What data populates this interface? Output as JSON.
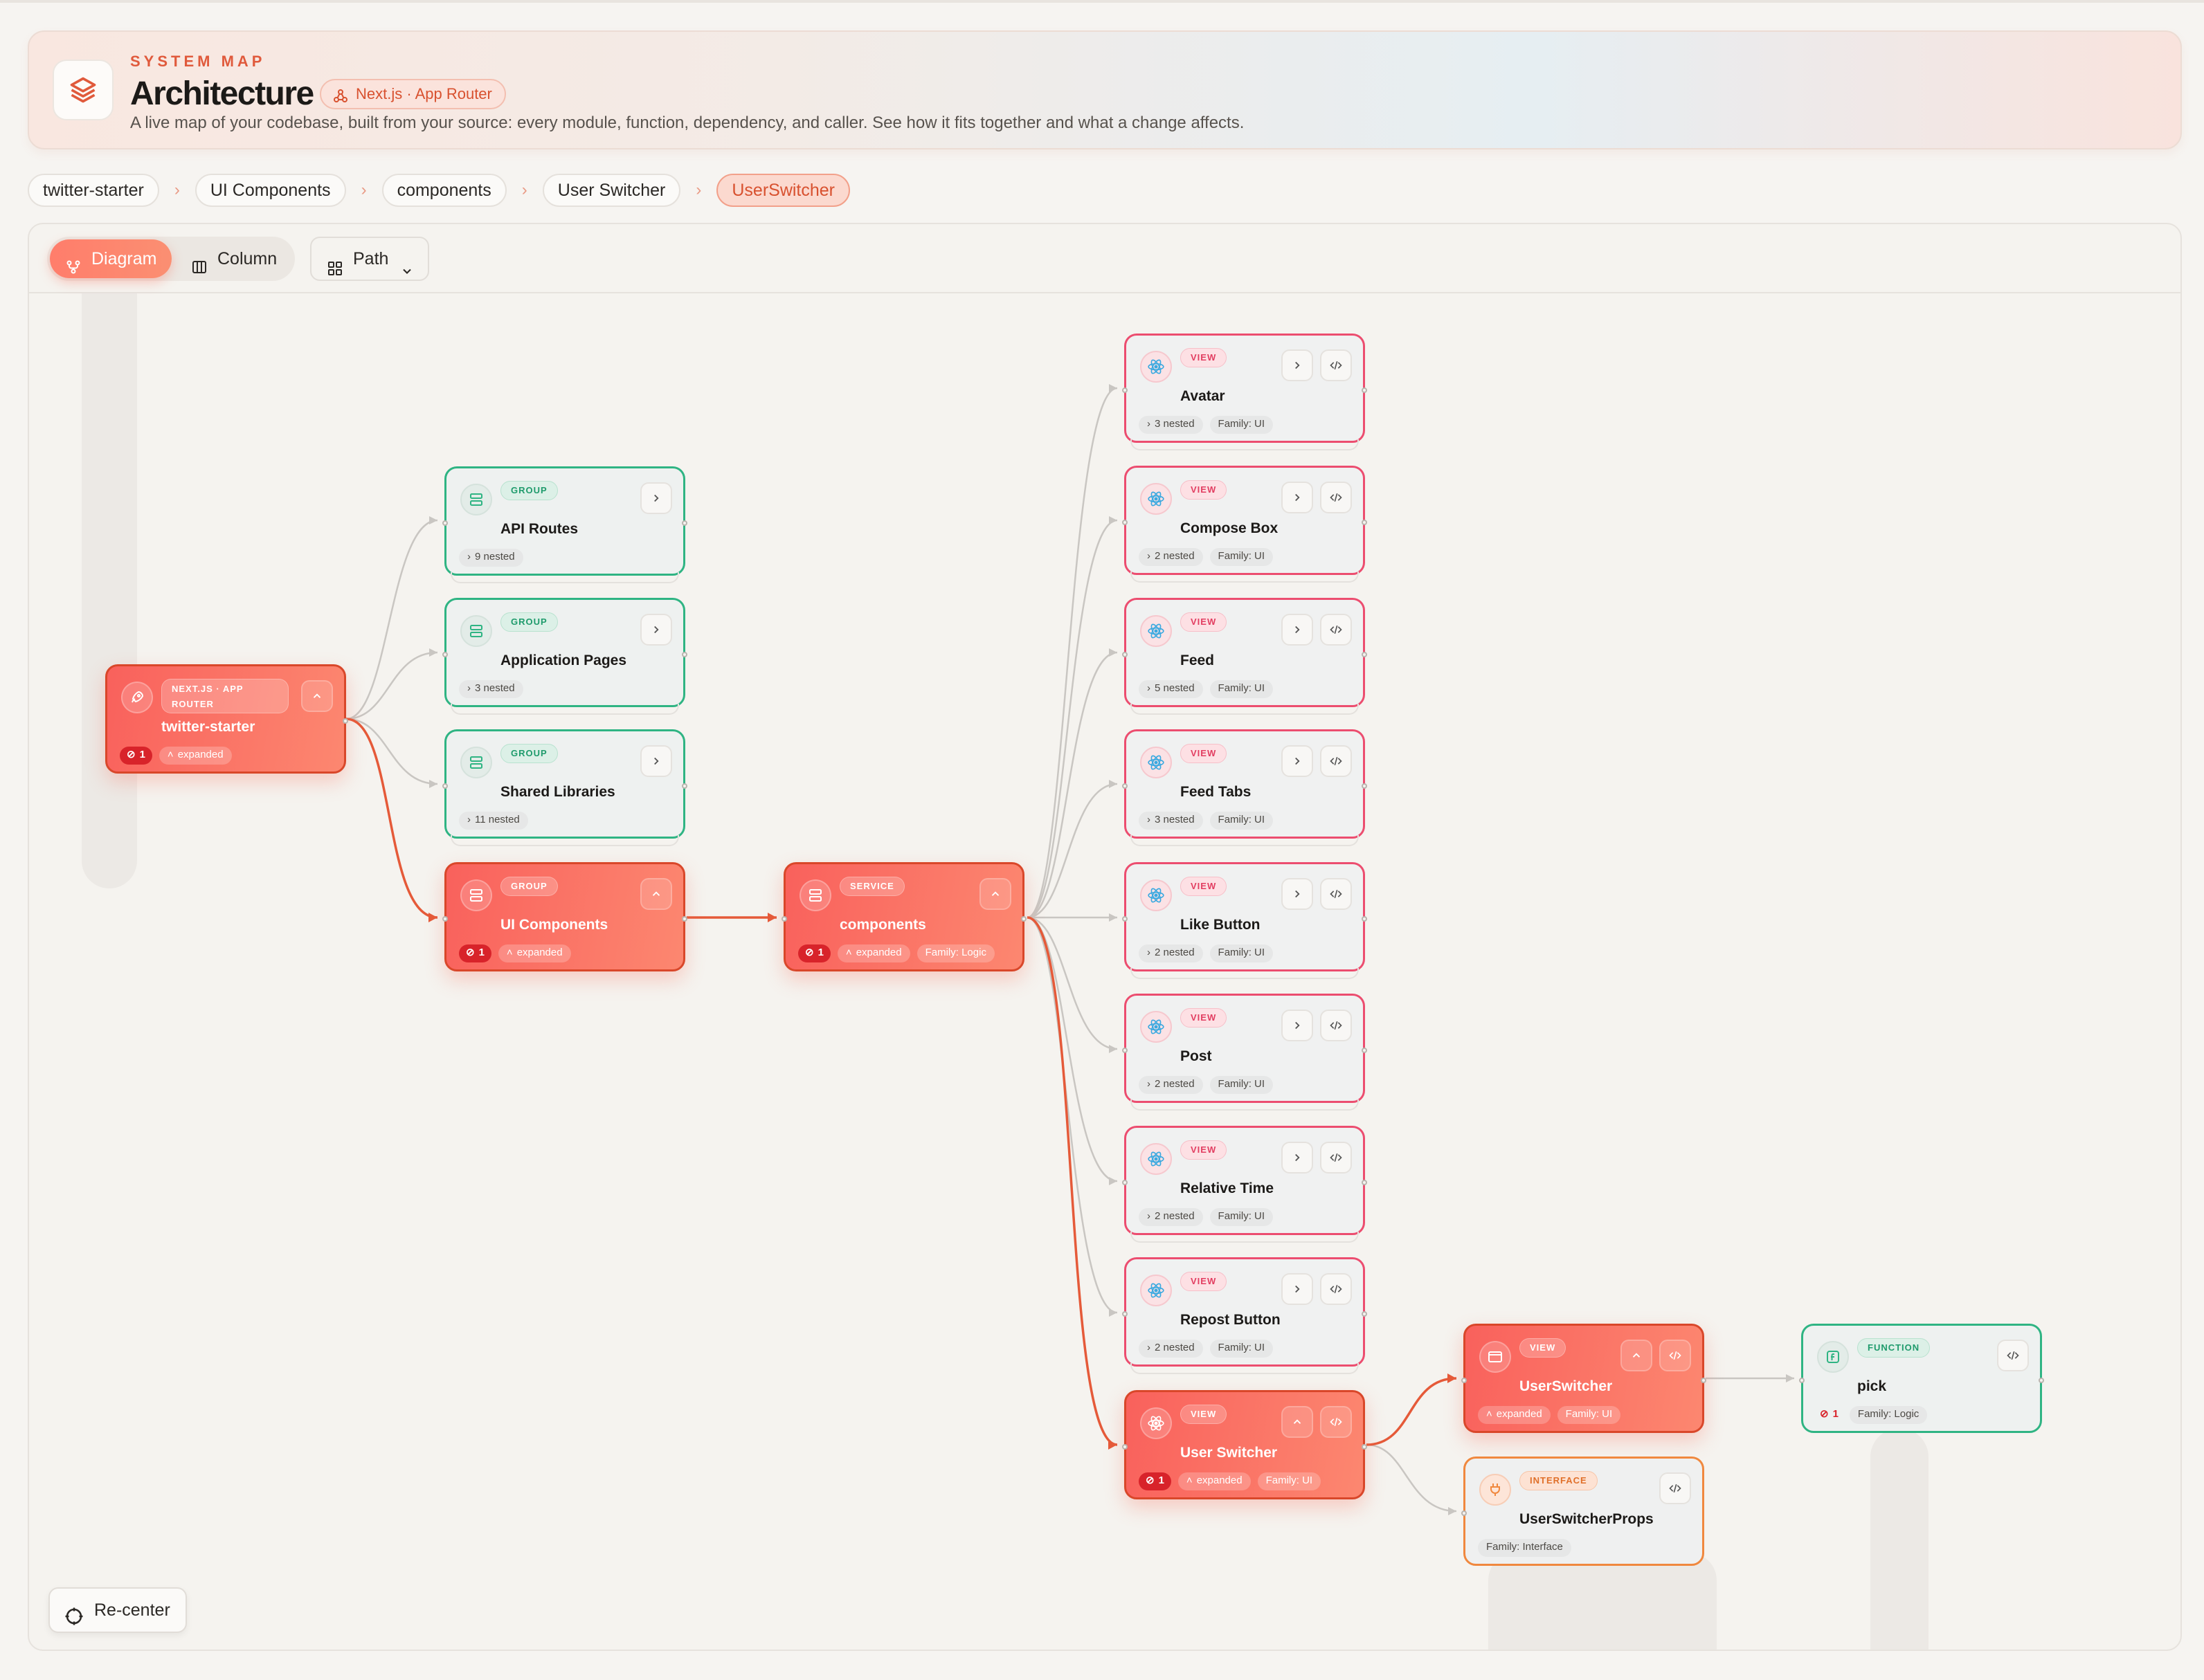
{
  "header": {
    "eyebrow": "SYSTEM MAP",
    "title": "Architecture",
    "framework_chip": "Next.js · App Router",
    "subtitle": "A live map of your codebase, built from your source: every module, function, dependency, and caller. See how it fits together and what a change affects."
  },
  "breadcrumbs": [
    "twitter-starter",
    "UI Components",
    "components",
    "User Switcher",
    "UserSwitcher"
  ],
  "toolbar": {
    "diagram_label": "Diagram",
    "column_label": "Column",
    "path_label": "Path"
  },
  "recenter_label": "Re-center",
  "colors": {
    "accent": "#fa6e5a",
    "group": "#2fb483",
    "view": "#ec4d6f",
    "interface": "#f0883e",
    "alert": "#d8232a"
  },
  "nodes": {
    "root": {
      "badge": "NEXT.JS · APP ROUTER",
      "title": "twitter-starter",
      "alert": "1",
      "state": "expanded"
    },
    "api_routes": {
      "badge": "GROUP",
      "title": "API Routes",
      "nested": "9 nested"
    },
    "app_pages": {
      "badge": "GROUP",
      "title": "Application Pages",
      "nested": "3 nested"
    },
    "shared_libs": {
      "badge": "GROUP",
      "title": "Shared Libraries",
      "nested": "11 nested"
    },
    "ui_components": {
      "badge": "GROUP",
      "title": "UI Components",
      "alert": "1",
      "state": "expanded"
    },
    "components": {
      "badge": "SERVICE",
      "title": "components",
      "alert": "1",
      "state": "expanded",
      "family": "Family: Logic"
    },
    "avatar": {
      "badge": "VIEW",
      "title": "Avatar",
      "nested": "3 nested",
      "family": "Family: UI"
    },
    "compose_box": {
      "badge": "VIEW",
      "title": "Compose Box",
      "nested": "2 nested",
      "family": "Family: UI"
    },
    "feed": {
      "badge": "VIEW",
      "title": "Feed",
      "nested": "5 nested",
      "family": "Family: UI"
    },
    "feed_tabs": {
      "badge": "VIEW",
      "title": "Feed Tabs",
      "nested": "3 nested",
      "family": "Family: UI"
    },
    "like_button": {
      "badge": "VIEW",
      "title": "Like Button",
      "nested": "2 nested",
      "family": "Family: UI"
    },
    "post": {
      "badge": "VIEW",
      "title": "Post",
      "nested": "2 nested",
      "family": "Family: UI"
    },
    "relative_time": {
      "badge": "VIEW",
      "title": "Relative Time",
      "nested": "2 nested",
      "family": "Family: UI"
    },
    "repost_button": {
      "badge": "VIEW",
      "title": "Repost Button",
      "nested": "2 nested",
      "family": "Family: UI"
    },
    "user_switcher": {
      "badge": "VIEW",
      "title": "User Switcher",
      "alert": "1",
      "state": "expanded",
      "family": "Family: UI"
    },
    "userswitcher": {
      "badge": "VIEW",
      "title": "UserSwitcher",
      "state": "expanded",
      "family": "Family: UI"
    },
    "userswitcherprops": {
      "badge": "INTERFACE",
      "title": "UserSwitcherProps",
      "family": "Family: Interface"
    },
    "pick": {
      "badge": "FUNCTION",
      "title": "pick",
      "alert": "1",
      "family": "Family: Logic"
    }
  }
}
